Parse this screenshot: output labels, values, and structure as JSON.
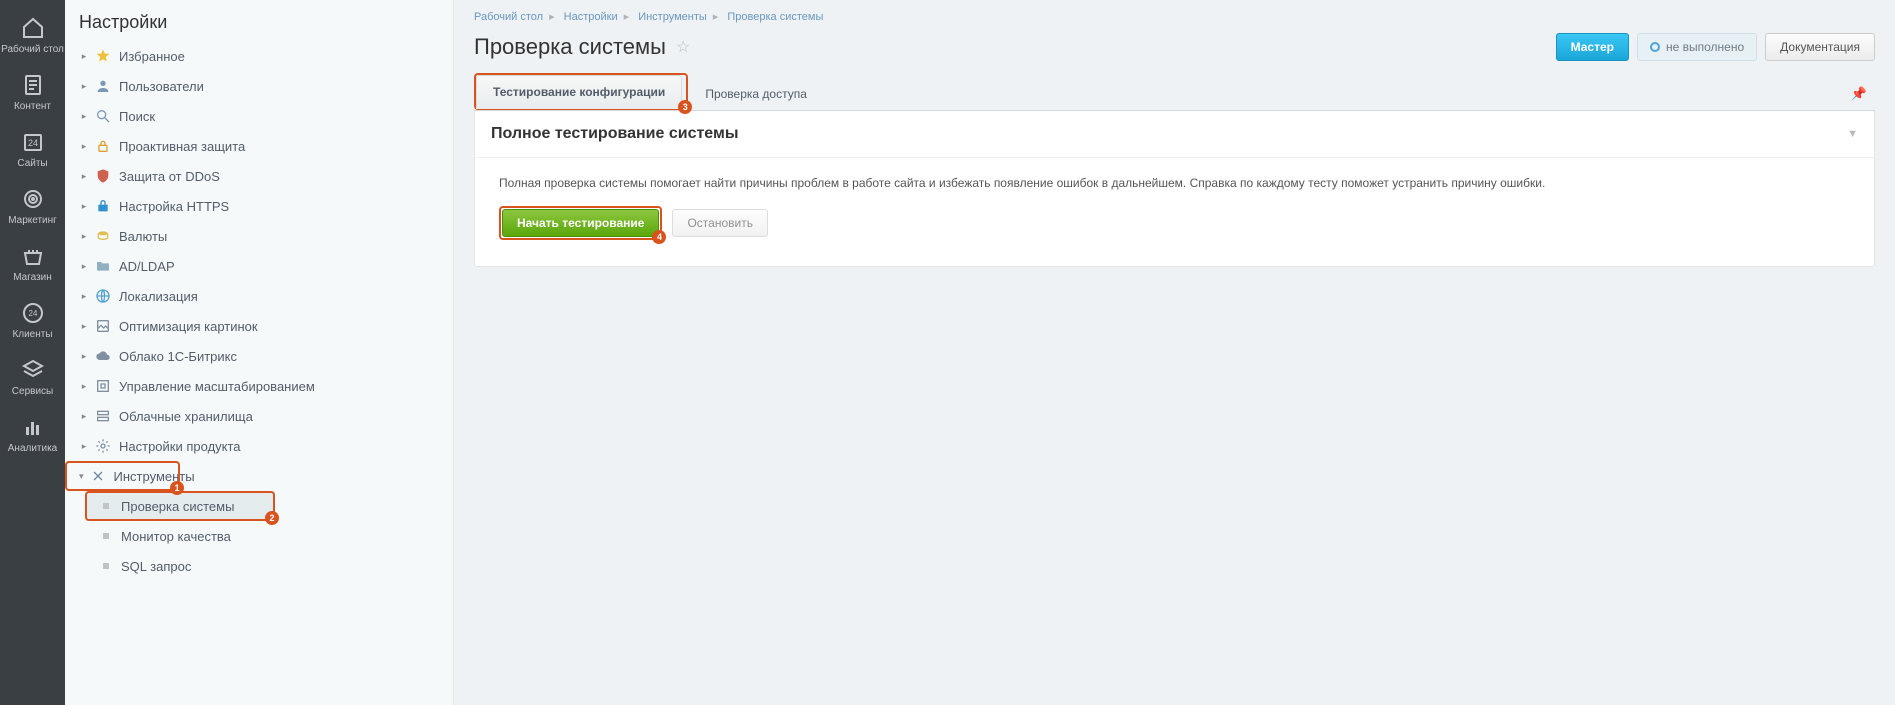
{
  "mainNav": [
    {
      "label": "Рабочий стол",
      "icon": "home"
    },
    {
      "label": "Контент",
      "icon": "doc"
    },
    {
      "label": "Сайты",
      "icon": "cal"
    },
    {
      "label": "Маркетинг",
      "icon": "target"
    },
    {
      "label": "Магазин",
      "icon": "basket"
    },
    {
      "label": "Клиенты",
      "icon": "clients"
    },
    {
      "label": "Сервисы",
      "icon": "layers"
    },
    {
      "label": "Аналитика",
      "icon": "bars"
    }
  ],
  "sidebar": {
    "title": "Настройки",
    "items": [
      {
        "label": "Избранное",
        "icon": "star",
        "color": "#f0c040"
      },
      {
        "label": "Пользователи",
        "icon": "user",
        "color": "#7b99b5"
      },
      {
        "label": "Поиск",
        "icon": "search",
        "color": "#7b99b5"
      },
      {
        "label": "Проактивная защита",
        "icon": "lock",
        "color": "#e0a030"
      },
      {
        "label": "Защита от DDoS",
        "icon": "shield",
        "color": "#d06050"
      },
      {
        "label": "Настройка HTTPS",
        "icon": "https",
        "color": "#3090d0"
      },
      {
        "label": "Валюты",
        "icon": "coin",
        "color": "#e0c050"
      },
      {
        "label": "AD/LDAP",
        "icon": "folder",
        "color": "#90b0c0"
      },
      {
        "label": "Локализация",
        "icon": "globe",
        "color": "#50a0d0"
      },
      {
        "label": "Оптимизация картинок",
        "icon": "opt",
        "color": "#8090a0"
      },
      {
        "label": "Облако 1С-Битрикс",
        "icon": "cloud",
        "color": "#8090a0"
      },
      {
        "label": "Управление масштабированием",
        "icon": "scale",
        "color": "#8090a0"
      },
      {
        "label": "Облачные хранилища",
        "icon": "storage",
        "color": "#8090a0"
      },
      {
        "label": "Настройки продукта",
        "icon": "product",
        "color": "#8090a0"
      },
      {
        "label": "Инструменты",
        "icon": "tools",
        "color": "#7088a0",
        "expanded": true,
        "callout": 1,
        "children": [
          {
            "label": "Проверка системы",
            "active": true,
            "callout": 2
          },
          {
            "label": "Монитор качества"
          },
          {
            "label": "SQL запрос"
          }
        ]
      }
    ]
  },
  "breadcrumb": [
    "Рабочий стол",
    "Настройки",
    "Инструменты",
    "Проверка системы"
  ],
  "page": {
    "title": "Проверка системы",
    "masterBtn": "Мастер",
    "statusText": "не выполнено",
    "docBtn": "Документация"
  },
  "tabs": [
    {
      "label": "Тестирование конфигурации",
      "active": true,
      "callout": 3
    },
    {
      "label": "Проверка доступа"
    }
  ],
  "panel": {
    "title": "Полное тестирование системы",
    "desc": "Полная проверка системы помогает найти причины проблем в работе сайта и избежать появление ошибок в дальнейшем. Справка по каждому тесту поможет устранить причину ошибки.",
    "startBtn": "Начать тестирование",
    "stopBtn": "Остановить",
    "startCallout": 4
  }
}
